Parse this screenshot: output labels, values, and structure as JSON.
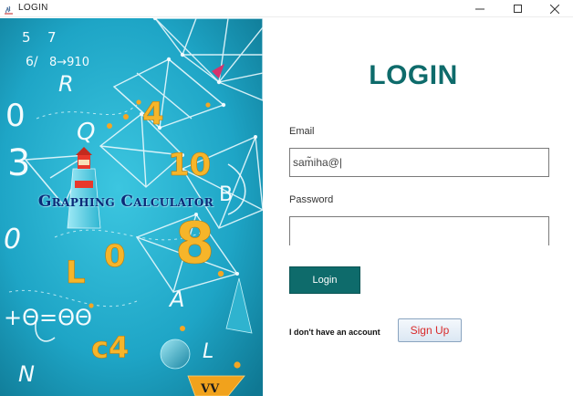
{
  "window": {
    "title": "LOGIN",
    "controls": {
      "minimize_icon": "minimize-icon",
      "maximize_icon": "maximize-icon",
      "close_icon": "close-icon"
    }
  },
  "artwork": {
    "title": "Graphing Calculator",
    "glyphs": {
      "g1": "5",
      "g2": "7",
      "g3": "6/",
      "g4": "8→910",
      "g5": "R",
      "g6": "0",
      "g7": "Q",
      "g8": "3",
      "g9": "4",
      "g10": "10",
      "g11": "B",
      "g12": "0",
      "g13": "L",
      "g14": "0",
      "g15": "8",
      "g16": "+Θ=ΘΘ",
      "g17": "A",
      "g18": "c4",
      "g19": "N",
      "g20": "L",
      "g21": "VV"
    }
  },
  "form": {
    "heading": "LOGIN",
    "email_label": "Email",
    "email_value": "sam̃iha@|",
    "password_label": "Password",
    "password_value": "",
    "login_button": "Login",
    "no_account_text": "I don't have an account",
    "signup_button": "Sign Up"
  },
  "colors": {
    "accent": "#0e6b6b",
    "signup_text": "#d82a2a",
    "art_background": "#1fa9c9",
    "art_title": "#0b2a78"
  }
}
